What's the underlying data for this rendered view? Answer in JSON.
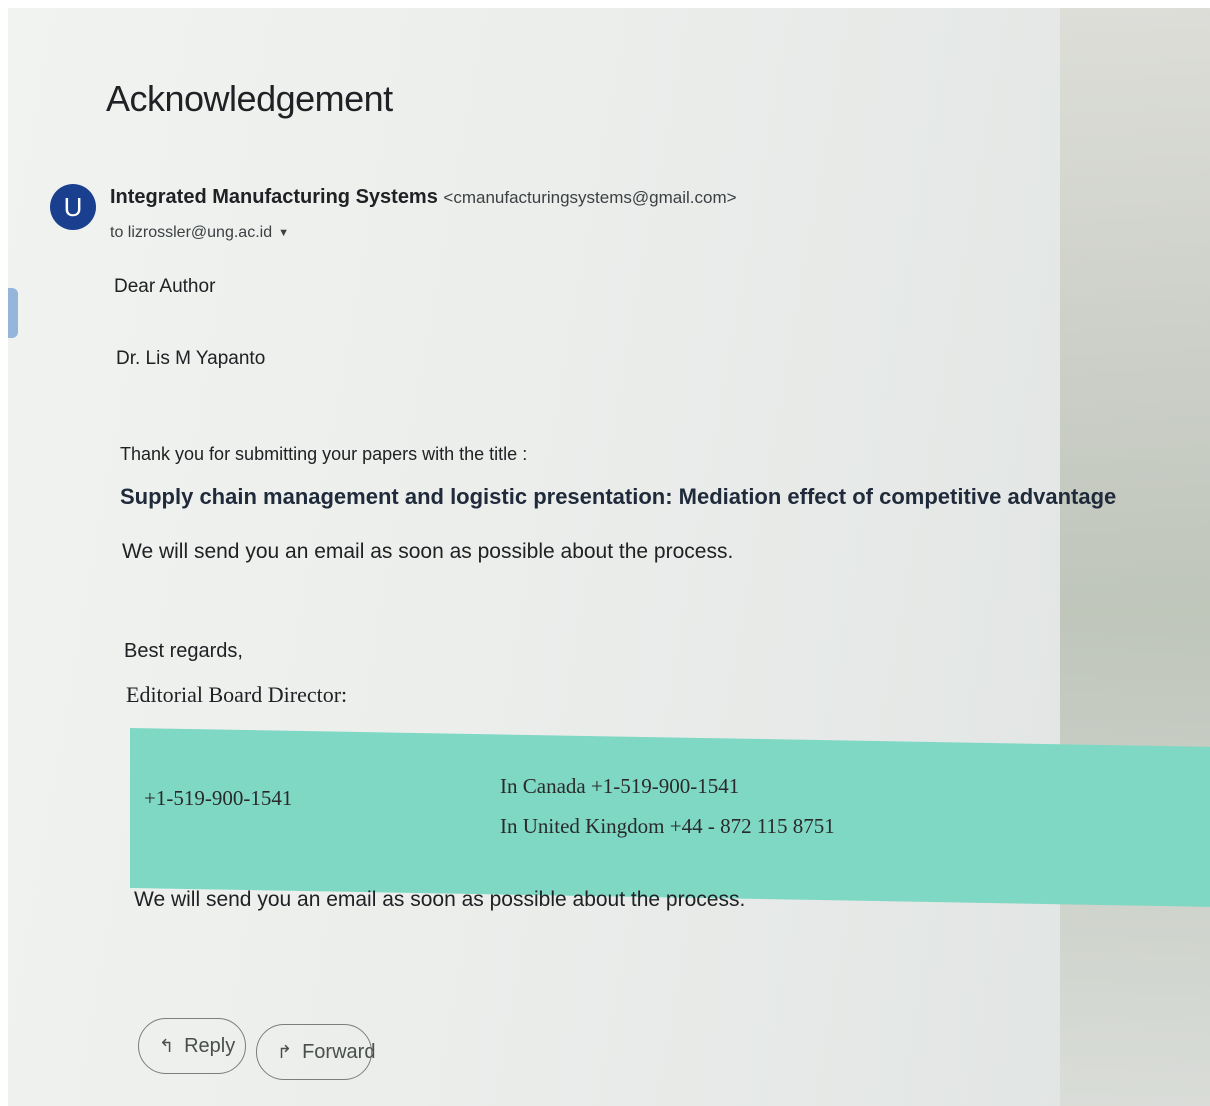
{
  "email": {
    "subject": "Acknowledgement",
    "avatar_letter": "U",
    "sender_name": "Integrated Manufacturing Systems",
    "sender_email": "<cmanufacturingsystems@gmail.com>",
    "recipient": "to lizrossler@ung.ac.id"
  },
  "body": {
    "greeting": "Dear Author",
    "author": "Dr. Lis M Yapanto",
    "thanks": "Thank you for submitting your papers with the title :",
    "paper_title": "Supply chain management and logistic presentation: Mediation effect of competitive advantage",
    "process_note": "We will send you an email as soon as possible about the process.",
    "regards": "Best regards,",
    "director": "Editorial Board Director:",
    "contact": {
      "phone_main": "+1-519-900-1541",
      "canada": "In Canada +1-519-900-1541",
      "uk": "In United Kingdom +44 - 872 115 8751"
    },
    "process_note_repeat": "We will send you an email as soon as possible about the process."
  },
  "actions": {
    "reply_label": "Reply",
    "forward_label": "Forward",
    "reply_icon": "reply-icon",
    "forward_icon": "forward-icon"
  },
  "colors": {
    "avatar": "#1a3f8f",
    "contact_band": "#7fd8c4"
  }
}
